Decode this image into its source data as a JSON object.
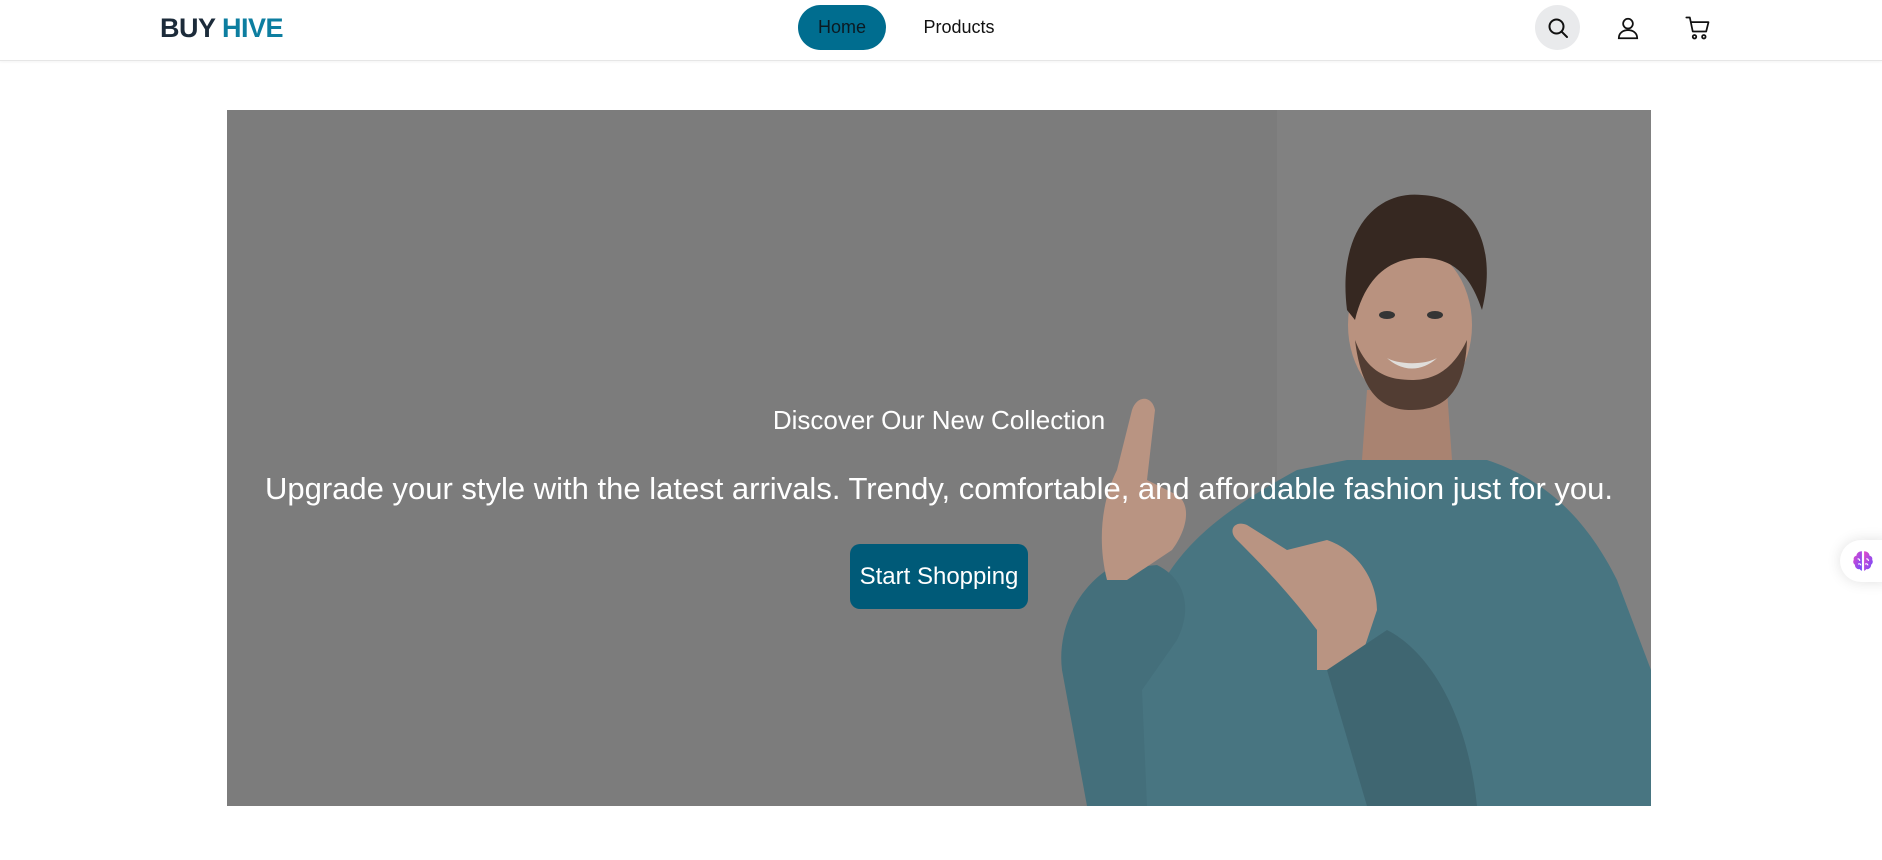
{
  "brand": {
    "part1": "BUY",
    "part2": "HIVE"
  },
  "nav": {
    "items": [
      {
        "label": "Home",
        "active": true
      },
      {
        "label": "Products",
        "active": false
      }
    ]
  },
  "header_icons": [
    "search-icon",
    "user-icon",
    "cart-icon"
  ],
  "hero": {
    "subtitle": "Discover Our New Collection",
    "tagline": "Upgrade your style with the latest arrivals. Trendy, comfortable, and affordable fashion just for you.",
    "cta_label": "Start Shopping"
  },
  "colors": {
    "brand_dark": "#1c2b3a",
    "brand_accent": "#0d7ea0",
    "nav_active_bg": "#006d8f",
    "cta_bg": "#005a78",
    "hero_overlay": "#808080"
  },
  "floating_widget": {
    "icon": "brain-icon"
  }
}
